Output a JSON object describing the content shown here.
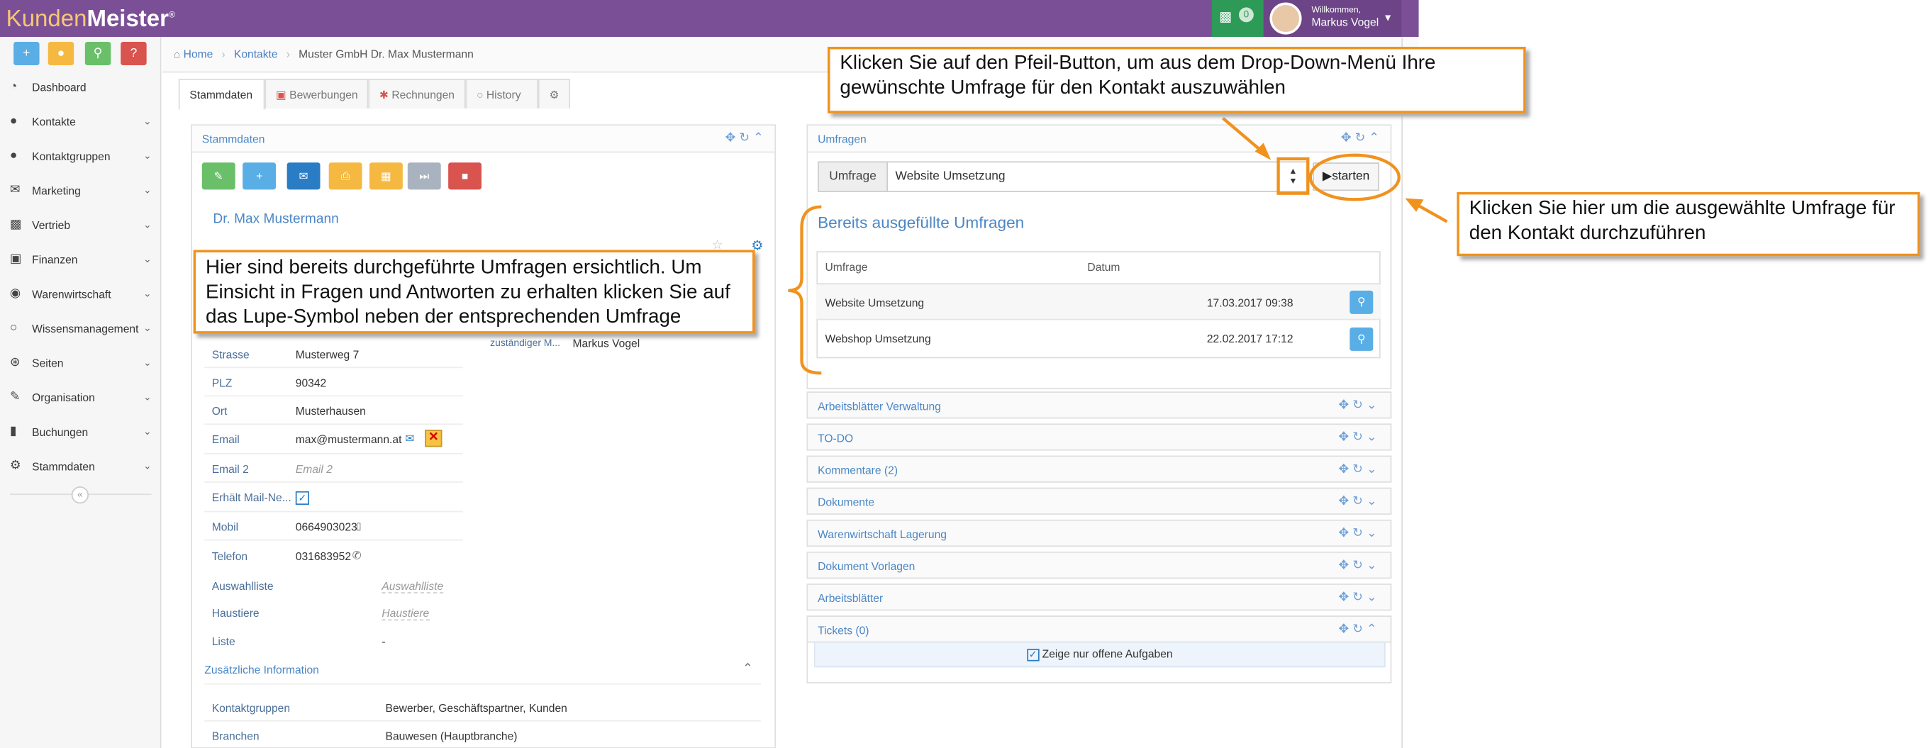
{
  "app": {
    "brand_a": "Kunden",
    "brand_b": "Meister",
    "brand_mark": "®"
  },
  "header": {
    "chat_count": "0",
    "welcome": "Willkommen,",
    "user": "Markus Vogel"
  },
  "quick": {
    "add": "+",
    "chat": "💬",
    "search": "🔍",
    "help": "?"
  },
  "nav": [
    "Dashboard",
    "Kontakte",
    "Kontaktgruppen",
    "Marketing",
    "Vertrieb",
    "Finanzen",
    "Warenwirtschaft",
    "Wissensmanagement",
    "Seiten",
    "Organisation",
    "Buchungen",
    "Stammdaten"
  ],
  "breadcrumb": {
    "home": "Home",
    "contacts": "Kontakte",
    "current": "Muster GmbH Dr. Max Mustermann"
  },
  "tabs": {
    "stamm": "Stammdaten",
    "bew": "Bewerbungen",
    "rech": "Rechnungen",
    "hist": "History"
  },
  "left": {
    "title": "Stammdaten",
    "name": "Dr. Max Mustermann",
    "fields": [
      {
        "label": "Strasse",
        "value": "Musterweg 7"
      },
      {
        "label": "PLZ",
        "value": "90342"
      },
      {
        "label": "Ort",
        "value": "Musterhausen"
      },
      {
        "label": "Email",
        "value": "max@mustermann.at"
      },
      {
        "label": "Email 2",
        "value": "Email 2"
      },
      {
        "label": "Erhält Mail-Ne...",
        "value": ""
      },
      {
        "label": "Mobil",
        "value": "0664903023"
      },
      {
        "label": "Telefon",
        "value": "031683952"
      },
      {
        "label": "Auswahlliste",
        "value": "Auswahlliste"
      },
      {
        "label": "Haustiere",
        "value": "Haustiere"
      },
      {
        "label": "Liste",
        "value": "-"
      }
    ],
    "resp_label": "zuständiger M...",
    "resp_value": "Markus Vogel",
    "extra_title": "Zusätzliche Information",
    "groups_label": "Kontaktgruppen",
    "groups_value": "Bewerber, Geschäftspartner, Kunden",
    "branch_label": "Branchen",
    "branch_value": "Bauwesen (Hauptbranche)"
  },
  "survey": {
    "title": "Umfragen",
    "label": "Umfrage",
    "selected": "Website Umsetzung",
    "start": "starten",
    "done_title": "Bereits ausgefüllte Umfragen",
    "col_name": "Umfrage",
    "col_date": "Datum",
    "rows": [
      {
        "name": "Website Umsetzung",
        "date": "17.03.2017 09:38"
      },
      {
        "name": "Webshop Umsetzung",
        "date": "22.02.2017 17:12"
      }
    ]
  },
  "collapsed": [
    "Arbeitsblätter Verwaltung",
    "TO-DO",
    "Kommentare (2)",
    "Dokumente",
    "Warenwirtschaft Lagerung",
    "Dokument Vorlagen",
    "Arbeitsblätter",
    "Tickets (0)"
  ],
  "tickets_check": "Zeige nur offene Aufgaben",
  "callouts": {
    "top": "Klicken Sie auf den Pfeil-Button, um aus dem Drop-Down-Menü Ihre gewünschte Umfrage für  den Kontakt auszuwählen",
    "right": "Klicken Sie hier um die ausgewählte Umfrage für den Kontakt durchzuführen",
    "left": "Hier sind bereits durchgeführte Umfragen ersichtlich. Um Einsicht in Fragen und Antworten zu erhalten klicken Sie auf das Lupe-Symbol neben der entsprechenden Umfrage"
  },
  "colors": {
    "header": "#7b4f96",
    "accent": "#f0921e",
    "link": "#4a86c5"
  }
}
